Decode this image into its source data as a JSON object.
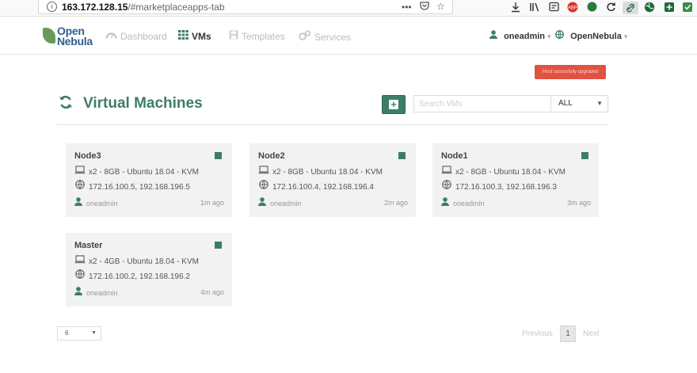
{
  "browser": {
    "url_host": "163.172.128.15",
    "url_path": "/#marketplaceapps-tab",
    "info_icon": "info-icon",
    "more_glyph": "•••",
    "toolbar_icons": [
      "download-icon",
      "library-icon",
      "reader-icon",
      "extension-red-icon",
      "extension-green-icon",
      "refresh-icon",
      "link-icon",
      "globe-icon",
      "add-icon",
      "extension-icon"
    ]
  },
  "nav": {
    "logo_line1": "Open",
    "logo_line2": "Nebula",
    "items": [
      {
        "label": "Dashboard",
        "icon": "dashboard-icon"
      },
      {
        "label": "VMs",
        "icon": "vms-icon",
        "active": true
      },
      {
        "label": "Templates",
        "icon": "templates-icon"
      },
      {
        "label": "Services",
        "icon": "services-icon"
      }
    ],
    "user": "oneadmin",
    "zone": "OpenNebula"
  },
  "toast": {
    "text": "Host sucessfully upgraded"
  },
  "page": {
    "title": "Virtual Machines",
    "search_placeholder": "Search VMs",
    "filter_value": "ALL"
  },
  "vms": [
    {
      "name": "Node3",
      "spec": "x2 - 8GB - Ubuntu 18.04 - KVM",
      "ips": "172.16.100.5, 192.168.196.5",
      "owner": "oneadmin",
      "time": "1m ago",
      "status_color": "#3d7d68"
    },
    {
      "name": "Node2",
      "spec": "x2 - 8GB - Ubuntu 18.04 - KVM",
      "ips": "172.16.100.4, 192.168.196.4",
      "owner": "oneadmin",
      "time": "2m ago",
      "status_color": "#3d7d68"
    },
    {
      "name": "Node1",
      "spec": "x2 - 8GB - Ubuntu 18.04 - KVM",
      "ips": "172.16.100.3, 192.168.196.3",
      "owner": "oneadmin",
      "time": "3m ago",
      "status_color": "#3d7d68"
    },
    {
      "name": "Master",
      "spec": "x2 - 4GB - Ubuntu 18.04 - KVM",
      "ips": "172.16.100.2, 192.168.196.2",
      "owner": "oneadmin",
      "time": "4m ago",
      "status_color": "#3d7d68"
    }
  ],
  "pagination": {
    "page_size": "6",
    "previous": "Previous",
    "current": "1",
    "next": "Next"
  },
  "colors": {
    "accent": "#3d7d68",
    "toast": "#e15241"
  }
}
